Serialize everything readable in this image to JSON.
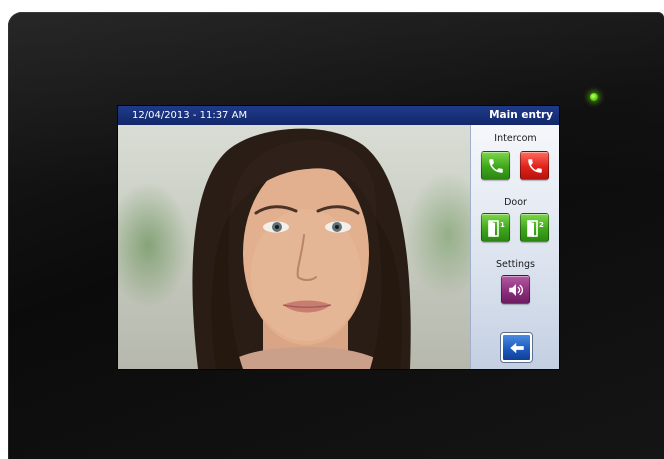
{
  "status_bar": {
    "datetime": "12/04/2013 - 11:37 AM",
    "location": "Main entry"
  },
  "intercom": {
    "label": "Intercom",
    "answer_icon": "phone-answer-icon",
    "hangup_icon": "phone-hangup-icon"
  },
  "door": {
    "label": "Door",
    "door1_icon": "door-open-icon",
    "door1_number": "1",
    "door2_icon": "door-open-icon",
    "door2_number": "2"
  },
  "settings": {
    "label": "Settings",
    "volume_icon": "speaker-volume-icon"
  },
  "back": {
    "icon": "back-arrow-icon"
  },
  "colors": {
    "top_bar": "#1f3a8a",
    "answer": "#3ea71c",
    "hangup": "#e0231a",
    "settings": "#8d2f7d",
    "back": "#1d5bbf",
    "led": "#56d400"
  }
}
